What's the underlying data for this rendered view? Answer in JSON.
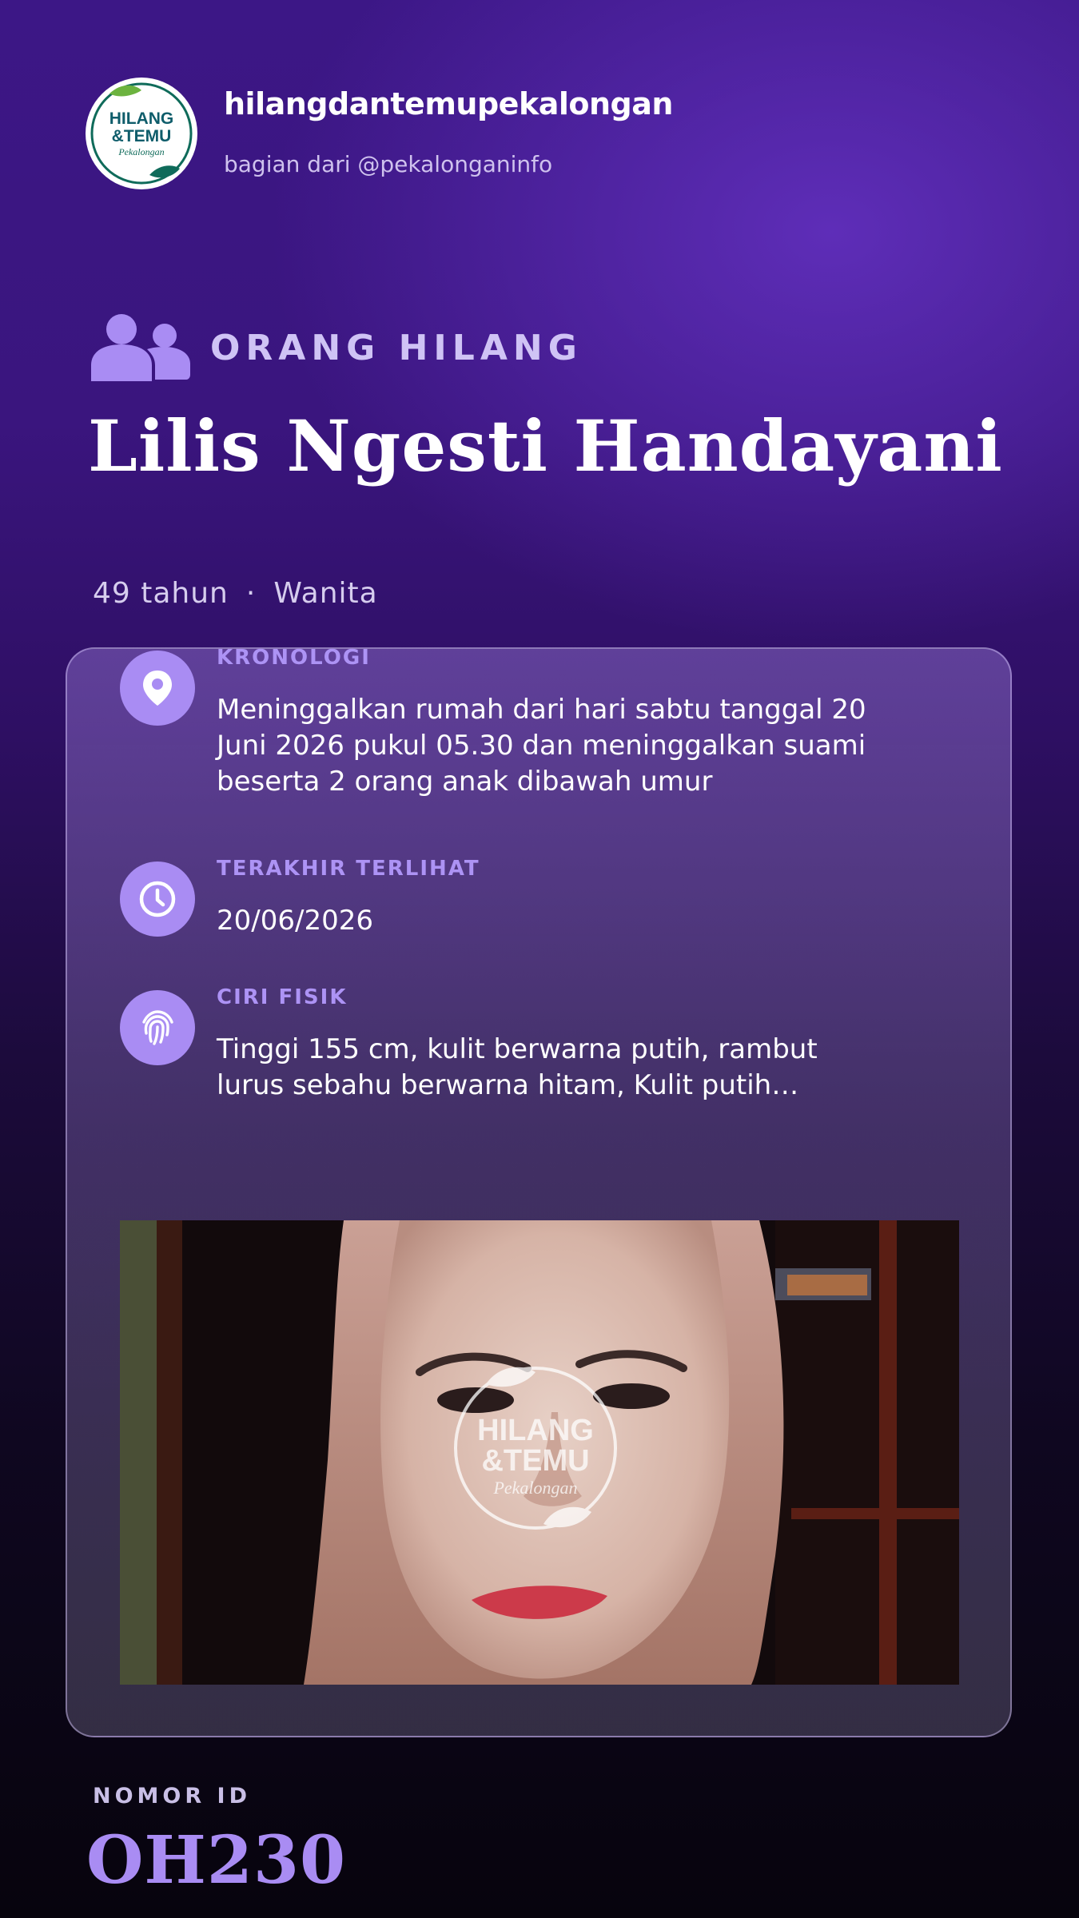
{
  "header": {
    "logo": {
      "line1": "HILANG",
      "line2": "&TEMU",
      "line3": "Pekalongan"
    },
    "account_name": "hilangdantemupekalongan",
    "account_sub": "bagian dari @pekalonganinfo"
  },
  "category": {
    "icon": "users-icon",
    "label": "ORANG HILANG"
  },
  "person": {
    "name": "Lilis Ngesti Handayani",
    "age": "49 tahun",
    "separator": "·",
    "gender": "Wanita"
  },
  "details": [
    {
      "icon": "location-pin-icon",
      "label": "KRONOLOGI",
      "value": "Meninggalkan rumah dari hari sabtu tanggal 20 Juni 2026 pukul 05.30 dan meninggalkan suami beserta 2 orang anak dibawah umur"
    },
    {
      "icon": "clock-icon",
      "label": "TERAKHIR TERLIHAT",
      "value": "20/06/2026"
    },
    {
      "icon": "fingerprint-icon",
      "label": "CIRI FISIK",
      "value": "Tinggi 155 cm, kulit berwarna putih, rambut lurus sebahu berwarna hitam, Kulit putih…"
    }
  ],
  "photo": {
    "watermark_line1": "HILANG",
    "watermark_line2": "&TEMU",
    "watermark_line3": "Pekalongan"
  },
  "id": {
    "label": "NOMOR ID",
    "value": "OH230"
  },
  "colors": {
    "accent": "#a98cf3",
    "background_top": "#3c1786",
    "background_bottom": "#07040d"
  }
}
